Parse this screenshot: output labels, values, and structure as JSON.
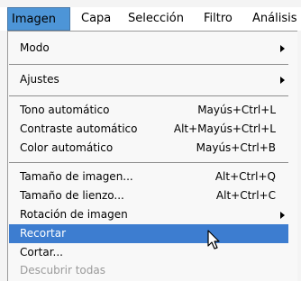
{
  "menubar": {
    "items": [
      "Imagen",
      "Capa",
      "Selección",
      "Filtro",
      "Análisis"
    ]
  },
  "menu": {
    "modo": "Modo",
    "ajustes": "Ajustes",
    "tono_auto": {
      "label": "Tono automático",
      "shortcut": "Mayús+Ctrl+L"
    },
    "contraste_auto": {
      "label": "Contraste automático",
      "shortcut": "Alt+Mayús+Ctrl+L"
    },
    "color_auto": {
      "label": "Color automático",
      "shortcut": "Mayús+Ctrl+B"
    },
    "tamano_imagen": {
      "label": "Tamaño de imagen...",
      "shortcut": "Alt+Ctrl+Q"
    },
    "tamano_lienzo": {
      "label": "Tamaño de lienzo...",
      "shortcut": "Alt+Ctrl+C"
    },
    "rotacion": "Rotación de imagen",
    "recortar": "Recortar",
    "cortar": "Cortar...",
    "descubrir": "Descubrir todas"
  }
}
